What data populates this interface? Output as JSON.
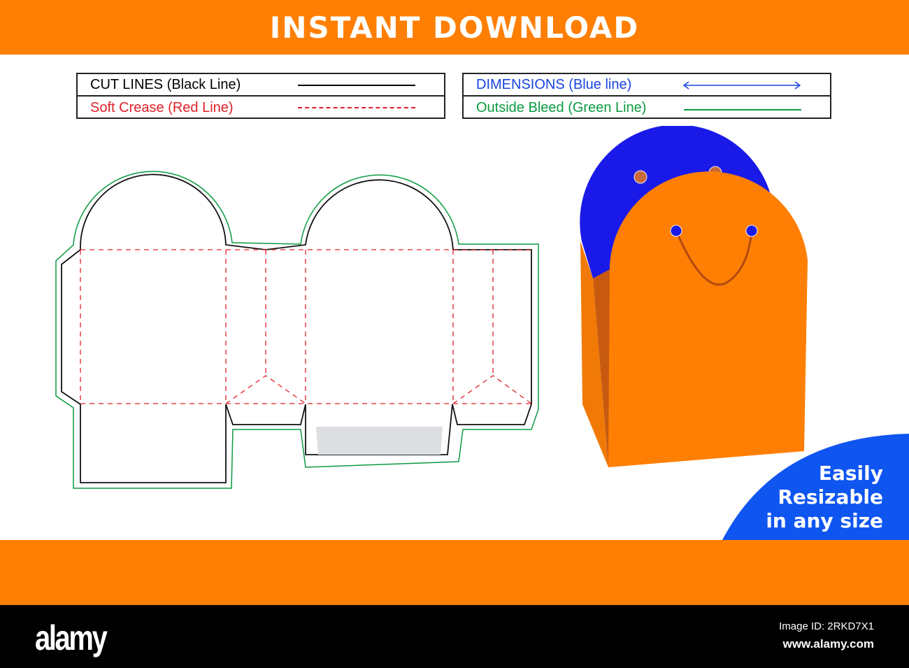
{
  "header": {
    "title": "INSTANT DOWNLOAD"
  },
  "legend": {
    "cut": {
      "label": "CUT LINES (Black Line)",
      "color": "#000000"
    },
    "crease": {
      "label": "Soft Crease (Red Line)",
      "color": "#e0202a"
    },
    "dimensions": {
      "label": "DIMENSIONS (Blue line)",
      "color": "#1844e0"
    },
    "bleed": {
      "label": "Outside Bleed (Green Line)",
      "color": "#0a9a40"
    }
  },
  "badge": {
    "line1": "Easily",
    "line2": "Resizable",
    "line3": "in any size",
    "color": "#0f55f0"
  },
  "colors": {
    "orange": "#fe7f03",
    "bag_blue": "#1a1ae8"
  },
  "footer": {
    "logo": "alamy",
    "image_id": "Image ID: 2RKD7X1",
    "site": "www.alamy.com"
  }
}
